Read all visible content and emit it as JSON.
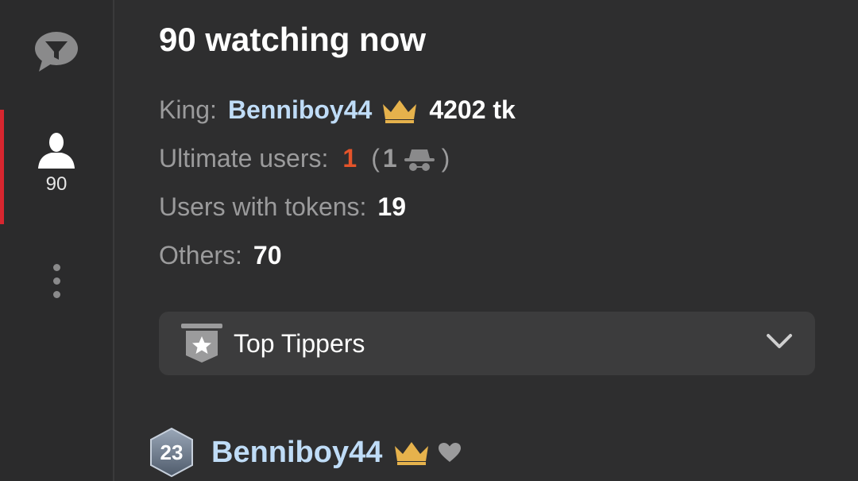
{
  "sidebar": {
    "viewer_count": "90"
  },
  "header": {
    "title": "90 watching now"
  },
  "stats": {
    "king_label": "King:",
    "king_name": "Benniboy44",
    "king_tokens": "4202 tk",
    "ultimate_label": "Ultimate users:",
    "ultimate_value": "1",
    "anon_open": "(",
    "anon_count": "1",
    "anon_close": ")",
    "tokens_label": "Users with tokens:",
    "tokens_value": "19",
    "others_label": "Others:",
    "others_value": "70"
  },
  "top_tippers": {
    "label": "Top Tippers"
  },
  "user_list": [
    {
      "level": "23",
      "name": "Benniboy44"
    }
  ],
  "colors": {
    "accent": "#d7262f",
    "username": "#bfdcf7",
    "crown": "#e6b24c",
    "ultimate": "#e4542a"
  }
}
